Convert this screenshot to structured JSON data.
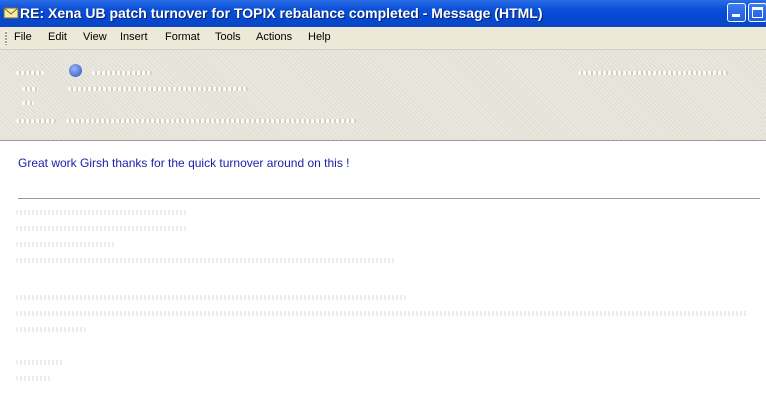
{
  "window": {
    "title": "RE: Xena UB patch turnover for TOPIX rebalance completed - Message (HTML)",
    "icon": "envelope-icon"
  },
  "menu": [
    "File",
    "Edit",
    "View",
    "Insert",
    "Format",
    "Tools",
    "Actions",
    "Help"
  ],
  "body": {
    "greeting": "Great work Girsh thanks for the quick turnover around on this !"
  },
  "colors": {
    "titlebar": "#0a4fd8",
    "greeting_text": "#1c1ca8",
    "header_bg": "#e3e1d5"
  }
}
